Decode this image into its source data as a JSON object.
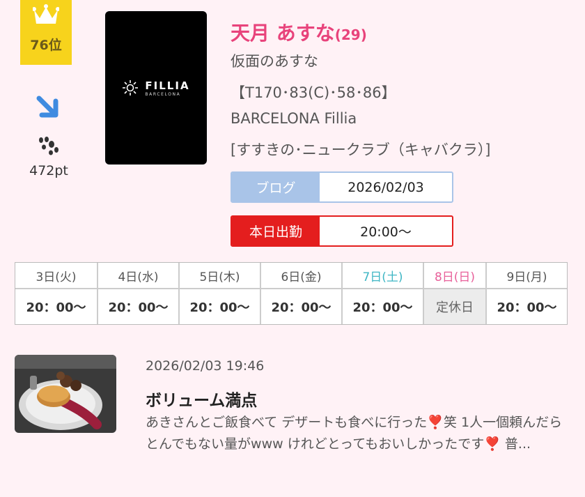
{
  "ranking": {
    "rank_label": "76位",
    "trend_icon": "arrow-down-right-icon",
    "points": "472pt"
  },
  "profile": {
    "name": "天月 あすな",
    "age": "(29)",
    "catchphrase": "仮面のあすな",
    "measurements": "【T170･83(C)･58･86】",
    "shop_name": "BARCELONA Fillia",
    "area_category": "[すすきの･ニュークラブ（キャバクラ）]"
  },
  "shop_logo": {
    "main_text": "FILLIA",
    "sub_text": "BARCELONA"
  },
  "blog_pill": {
    "label": "ブログ",
    "value": "2026/02/03"
  },
  "work_pill": {
    "label": "本日出勤",
    "value": "20:00〜"
  },
  "schedule": [
    {
      "date": "3日(火)",
      "time": "20：00〜"
    },
    {
      "date": "4日(水)",
      "time": "20：00〜"
    },
    {
      "date": "5日(木)",
      "time": "20：00〜"
    },
    {
      "date": "6日(金)",
      "time": "20：00〜"
    },
    {
      "date": "7日(土)",
      "time": "20：00〜"
    },
    {
      "date": "8日(日)",
      "time": "定休日"
    },
    {
      "date": "9日(月)",
      "time": "20：00〜"
    }
  ],
  "blog_post": {
    "datetime": "2026/02/03 19:46",
    "title": "ボリューム満点",
    "excerpt": "あきさんとご飯食べて デザートも食べに行った❣️笑 1人一個頼んだら とんでもない量がwww けれどとってもおいしかったです❣️ 普..."
  },
  "colors": {
    "accent_pink": "#e8437b",
    "badge_yellow": "#f7d31c",
    "blog_blue": "#a9c4e8",
    "work_red": "#e41e1e",
    "saturday": "#3fb6c4",
    "sunday": "#e8609a"
  }
}
